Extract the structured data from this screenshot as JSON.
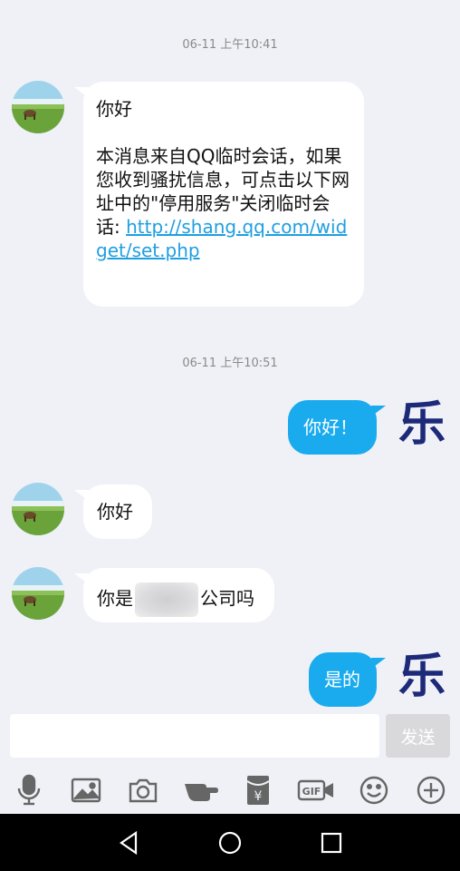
{
  "timestamps": [
    "06-11 上午10:41",
    "06-11 上午10:51"
  ],
  "messages": {
    "m1": {
      "greeting": "你好",
      "body_text": "本消息来自QQ临时会话，如果您收到骚扰信息，可点击以下网址中的\"停用服务\"关闭临时会话: ",
      "link": "http://shang.qq.com/widget/set.php"
    },
    "m2": {
      "text": "你好！"
    },
    "m3": {
      "text": "你好"
    },
    "m4": {
      "before": "你是",
      "after": "公司吗"
    },
    "m5": {
      "text": "是的"
    }
  },
  "self_avatar_glyph": "乐",
  "composer": {
    "placeholder": "",
    "send_label": "发送"
  },
  "toolbar": {
    "icons": [
      "microphone-icon",
      "image-icon",
      "camera-icon",
      "poke-icon",
      "red-packet-icon",
      "gif-icon",
      "emoji-icon",
      "plus-icon"
    ],
    "gif_label": "GIF",
    "yen_label": "¥"
  },
  "colors": {
    "outgoing_bubble": "#1aabee",
    "link": "#1f9fe0",
    "background": "#f0f1f6"
  }
}
